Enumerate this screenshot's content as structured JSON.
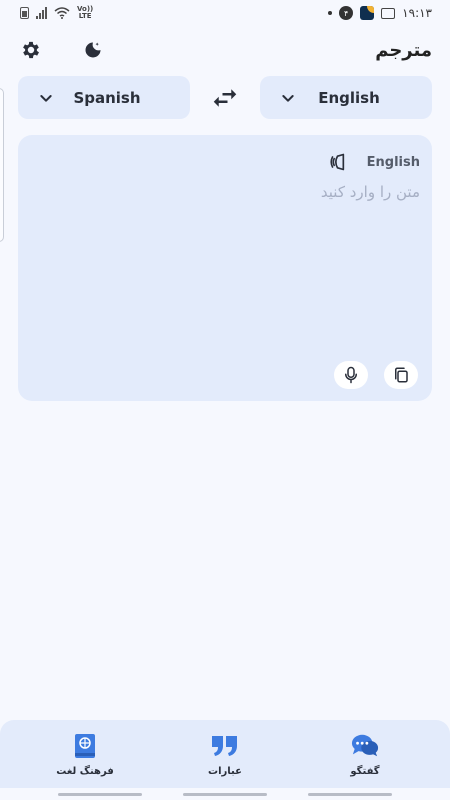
{
  "status_bar": {
    "volte_top": "Vo))",
    "volte_bottom": "LTE",
    "badge_count": "۴",
    "time": "۱۹:۱۳"
  },
  "header": {
    "title": "مترجم",
    "settings_icon": "gear-icon",
    "theme_icon": "moon-icon"
  },
  "languages": {
    "target": "Spanish",
    "source": "English",
    "swap_icon": "swap-arrows-icon"
  },
  "input_card": {
    "source_language": "English",
    "placeholder": "متن را وارد کنید",
    "value": ""
  },
  "bottom_nav": {
    "items": [
      {
        "label": "فرهنگ لغت",
        "icon": "dictionary-icon"
      },
      {
        "label": "عبارات",
        "icon": "quote-icon"
      },
      {
        "label": "گفتگو",
        "icon": "chat-bubbles-icon"
      }
    ]
  },
  "colors": {
    "accent": "#3d7be0",
    "card_background": "#e3ebfb",
    "page_background": "#f6f8fe"
  }
}
